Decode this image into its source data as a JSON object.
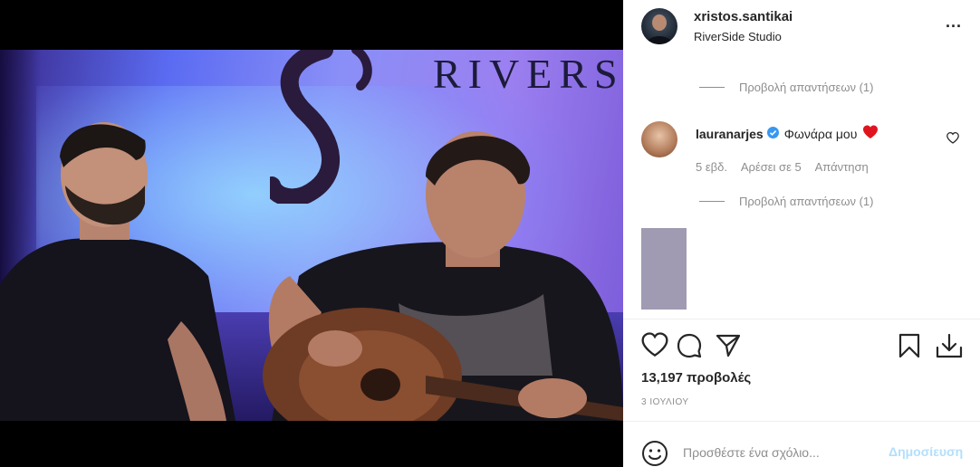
{
  "post": {
    "username": "xristos.santikai",
    "location": "RiverSide Studio",
    "more_icon": "more-horizontal-icon",
    "more_label": "..."
  },
  "media": {
    "sign_text": "RIVERS",
    "mute_icon": "volume-off-icon"
  },
  "comments": {
    "view_replies_1": "Προβολή απαντήσεων (1)",
    "comment": {
      "user": "lauranarjes",
      "text": "Φωνάρα μου",
      "time": "5 εβδ.",
      "likes": "Αρέσει σε 5",
      "reply": "Απάντηση"
    },
    "view_replies_2": "Προβολή απαντήσεων (1)"
  },
  "actions": {
    "views": "13,197 προβολές",
    "date": "3 ΙΟΥΛΙΟΥ"
  },
  "add_comment": {
    "placeholder": "Προσθέστε ένα σχόλιο...",
    "post_label": "Δημοσίευση"
  },
  "colors": {
    "heart_red": "#ed4956",
    "verified_blue": "#3897f0",
    "post_button_disabled": "#b2dffc"
  }
}
